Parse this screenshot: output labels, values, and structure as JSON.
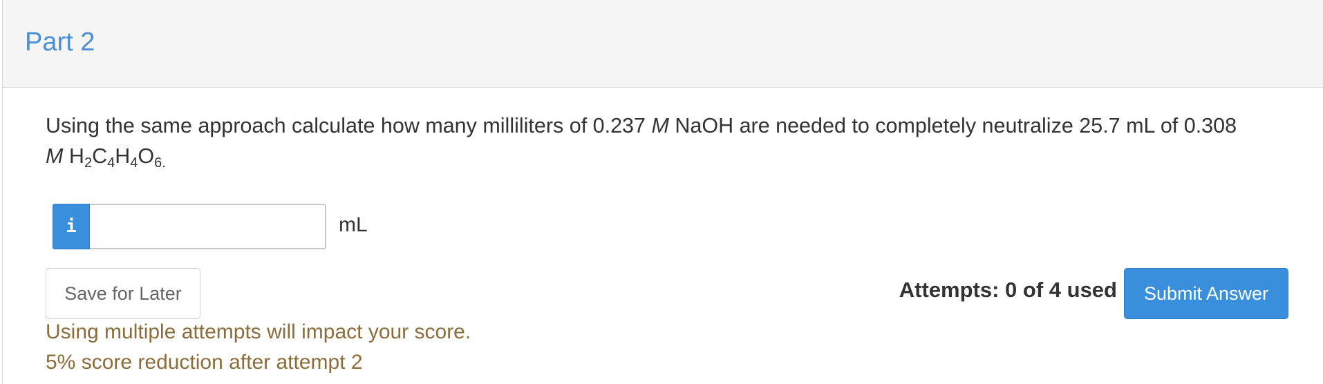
{
  "header": {
    "title": "Part 2"
  },
  "question": {
    "text_before": "Using the same approach calculate how many milliliters of 0.237 ",
    "molarity_symbol": "M",
    "text_middle": " NaOH are needed to completely neutralize 25.7 mL of 0.308",
    "molarity_symbol_2": "M",
    "formula_parts": [
      "H",
      "2",
      "C",
      "4",
      "H",
      "4",
      "O",
      "6",
      "."
    ]
  },
  "answer": {
    "info_icon": "i",
    "input_value": "",
    "input_placeholder": "",
    "unit": "mL"
  },
  "actions": {
    "save_label": "Save for Later",
    "attempts_label": "Attempts: 0 of 4 used",
    "submit_label": "Submit Answer"
  },
  "warnings": [
    "Using multiple attempts will impact your score.",
    "5% score reduction after attempt 2"
  ],
  "colors": {
    "accent": "#3a8fdc",
    "title": "#4a8fd8",
    "warning": "#8a6d3b"
  }
}
